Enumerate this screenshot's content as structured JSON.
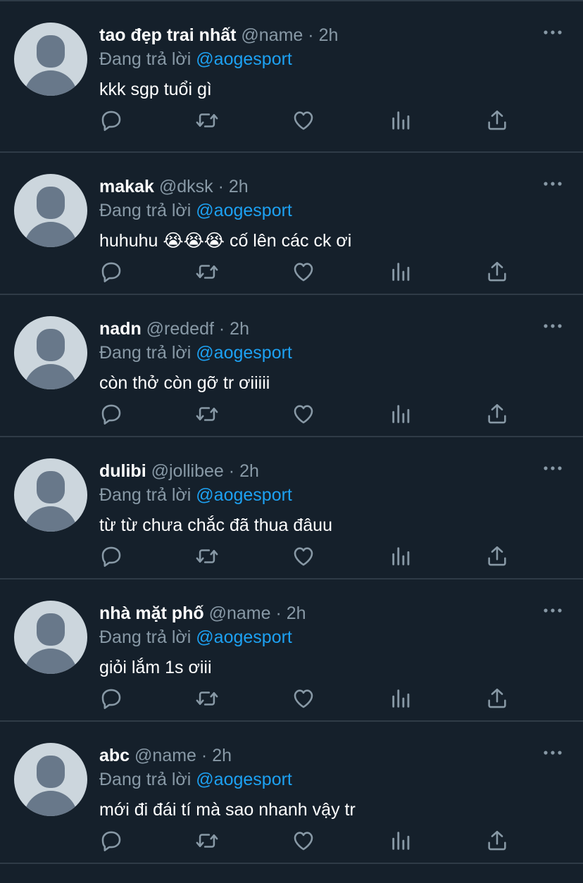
{
  "reply_prefix": "Đang trả lời",
  "icons": {
    "more": "more-horizontal-icon",
    "reply": "reply-icon",
    "retweet": "retweet-icon",
    "like": "heart-icon",
    "analytics": "analytics-icon",
    "share": "share-icon"
  },
  "colors": {
    "background": "#15202b",
    "divider": "#2f3b47",
    "muted": "#8899a6",
    "accent": "#1da1f2",
    "avatar_bg": "#ccd6dd",
    "avatar_fg": "#68788a"
  },
  "tweets": [
    {
      "name": "tao đẹp trai nhất",
      "handle": "@name",
      "sep": "·",
      "time": "2h",
      "reply_to": "@aogesport",
      "text": "kkk sgp tuổi gì"
    },
    {
      "name": "makak",
      "handle": "@dksk",
      "sep": "·",
      "time": "2h",
      "reply_to": "@aogesport",
      "text": "huhuhu 😭😭😭  cố lên các ck ơi"
    },
    {
      "name": "nadn",
      "handle": "@rededf",
      "sep": "·",
      "time": "2h",
      "reply_to": "@aogesport",
      "text": "còn thở còn gỡ tr ơiiiii"
    },
    {
      "name": "dulibi",
      "handle": "@jollibee",
      "sep": "·",
      "time": "2h",
      "reply_to": "@aogesport",
      "text": "từ từ chưa chắc đã thua đâuu"
    },
    {
      "name": "nhà mặt phố ",
      "handle": "@name",
      "sep": "·",
      "time": "2h",
      "reply_to": "@aogesport",
      "text": "giỏi lắm 1s ơiii"
    },
    {
      "name": "abc",
      "handle": "@name",
      "sep": "·",
      "time": "2h",
      "reply_to": "@aogesport",
      "text": "mới đi đái tí mà sao nhanh vậy tr"
    }
  ]
}
